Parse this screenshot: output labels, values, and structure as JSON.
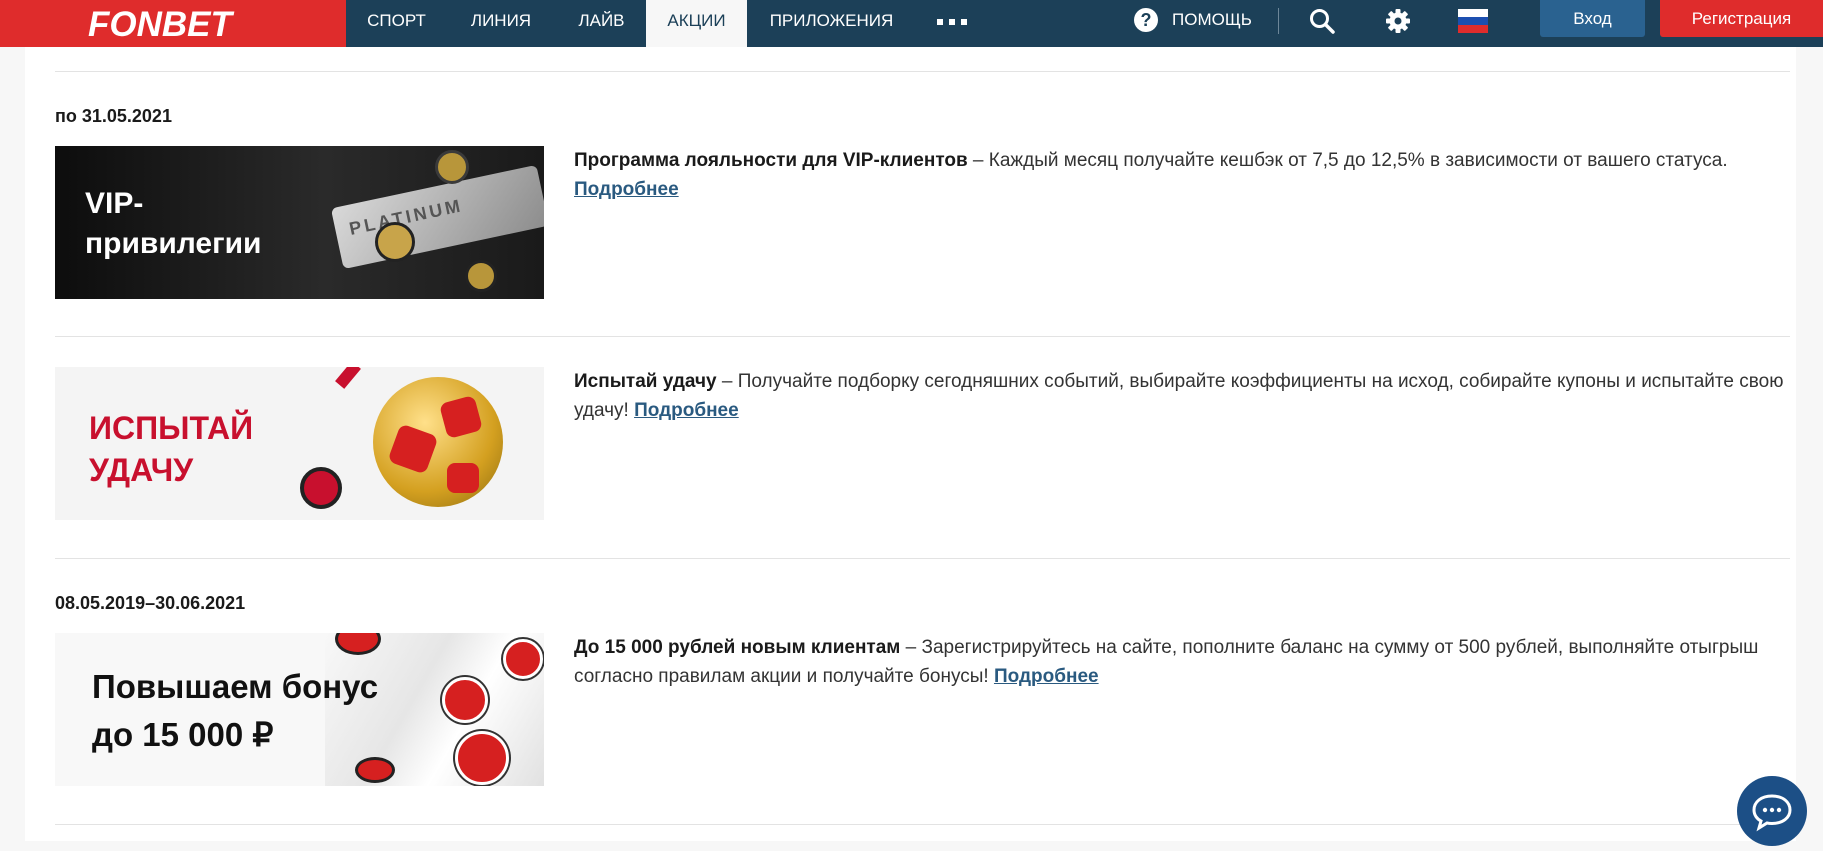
{
  "header": {
    "logo": "FONBET",
    "nav": [
      "СПОРТ",
      "ЛИНИЯ",
      "ЛАЙВ",
      "АКЦИИ",
      "ПРИЛОЖЕНИЯ"
    ],
    "active_nav": "АКЦИИ",
    "help_label": "ПОМОЩЬ",
    "help_icon": "question-circle-icon",
    "search_icon": "search-icon",
    "settings_icon": "gear-icon",
    "language_icon": "russia-flag-icon",
    "login_label": "Вход",
    "register_label": "Регистрация",
    "colors": {
      "bar": "#1c4058",
      "brand_red": "#df2c2c",
      "login": "#2a6290"
    }
  },
  "promotions": [
    {
      "date": "по 31.05.2021",
      "banner_lines": [
        "VIP-",
        "привилегии"
      ],
      "banner_card_text": "PLATINUM",
      "title": "Программа лояльности для VIP-клиентов",
      "description": " – Каждый месяц получайте кешбэк от 7,5 до 12,5% в зависимости от вашего статуса.",
      "link": "Подробнее"
    },
    {
      "date": "",
      "banner_lines": [
        "ИСПЫТАЙ",
        "УДАЧУ"
      ],
      "title": "Испытай удачу",
      "description": " – Получайте подборку сегодняшних событий, выбирайте коэффициенты на исход, собирайте купоны и испытайте свою удачу! ",
      "link": "Подробнее"
    },
    {
      "date": "08.05.2019–30.06.2021",
      "banner_lines": [
        "Повышаем бонус",
        "до 15 000 ₽"
      ],
      "title": "До 15 000 рублей новым клиентам",
      "description": " – Зарегистрируйтесь на сайте, пополните баланс на сумму от 500 рублей, выполняйте отыгрыш согласно правилам акции и получайте бонусы! ",
      "link": "Подробнее"
    }
  ],
  "chat_icon": "chat-bubble-icon"
}
